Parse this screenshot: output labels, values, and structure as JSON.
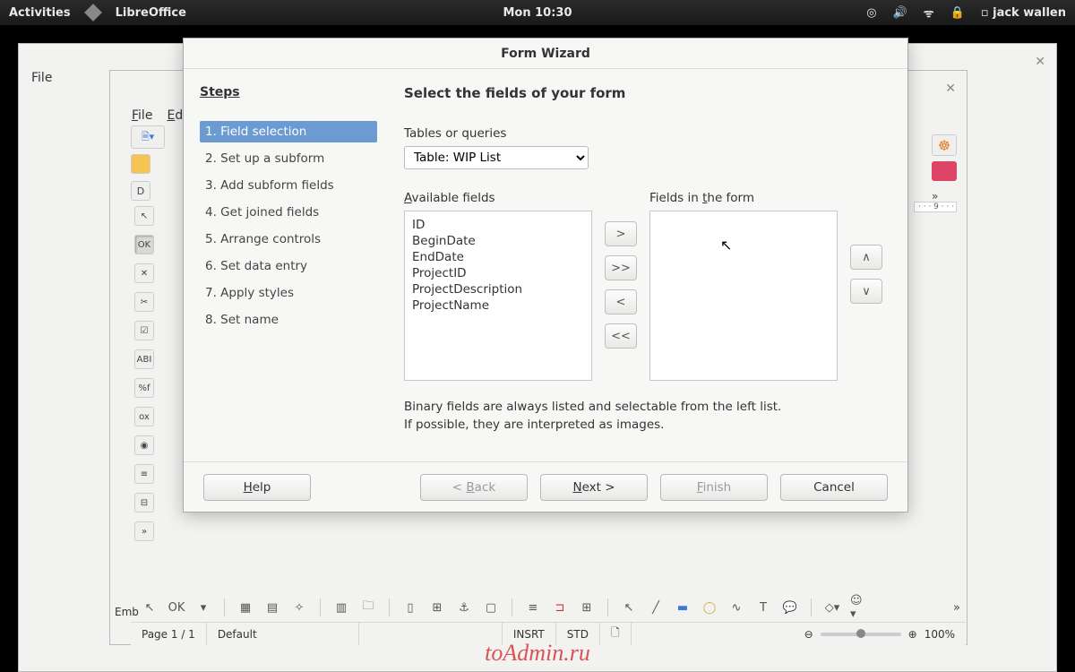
{
  "topbar": {
    "activities": "Activities",
    "app": "LibreOffice",
    "clock": "Mon 10:30",
    "user": "jack wallen"
  },
  "bgwin1": {
    "menu": "File"
  },
  "bgwin2": {
    "file": "File",
    "edit": "Ed"
  },
  "dialog": {
    "title": "Form Wizard",
    "steps_heading": "Steps",
    "steps": [
      "1. Field selection",
      "2. Set up a subform",
      "3. Add subform fields",
      "4. Get joined fields",
      "5. Arrange controls",
      "6. Set data entry",
      "7. Apply styles",
      "8. Set name"
    ],
    "active_step": 0,
    "heading": "Select the fields of your form",
    "tables_label": "Tables or queries",
    "tables_value": "Table: WIP List",
    "available_label": "Available fields",
    "available_fields": [
      "ID",
      "BeginDate",
      "EndDate",
      "ProjectID",
      "ProjectDescription",
      "ProjectName"
    ],
    "inform_label": "Fields in the form",
    "inform_fields": [],
    "move_buttons": {
      "add": ">",
      "add_all": ">>",
      "remove": "<",
      "remove_all": "<<"
    },
    "order_buttons": {
      "up": "∧",
      "down": "∨"
    },
    "hint1": "Binary fields are always listed and selectable from the left list.",
    "hint2": "If possible, they are interpreted as images.",
    "buttons": {
      "help": "Help",
      "back": "< Back",
      "next": "Next >",
      "finish": "Finish",
      "cancel": "Cancel"
    }
  },
  "status": {
    "page": "Page 1 / 1",
    "style": "Default",
    "insert": "INSRT",
    "std": "STD",
    "zoom": "100%"
  },
  "ruler_text": "· · · 9 · · · ",
  "embedded_label": "Emb",
  "watermark": "toAdmin.ru"
}
